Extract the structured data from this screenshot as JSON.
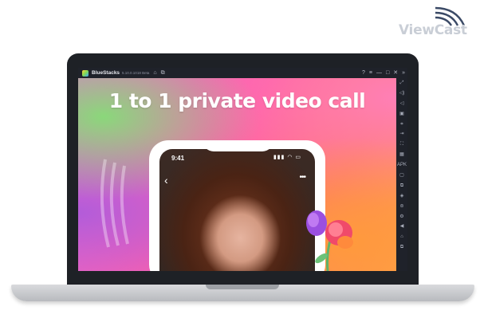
{
  "watermark": {
    "text": "ViewCast"
  },
  "titlebar": {
    "app_name": "BlueStacks",
    "version": "5.10.0.1018 Beta",
    "home_icon": "⌂",
    "multi_icon": "⧉",
    "right_icons": [
      "?",
      "≡",
      "—",
      "□",
      "✕",
      "»"
    ]
  },
  "app": {
    "headline": "1 to 1 private video call",
    "phone": {
      "time": "9:41",
      "status": "▮▮▮ ◠ ▭",
      "back_icon": "‹",
      "more_icon": "•••"
    }
  },
  "sidebar": {
    "icons": [
      "⤢",
      "◁)",
      "◁",
      "▣",
      "⌗",
      "⇥",
      "⛶",
      "▦",
      "APK",
      "▢",
      "⧉",
      "◈",
      "⊜",
      "⚙",
      "◀",
      "⌂",
      "⧉"
    ]
  },
  "colors": {
    "accent_green": "#8ad87a",
    "accent_pink": "#ff5fa8",
    "accent_orange": "#ffa24a",
    "accent_purple": "#b35cd9",
    "laptop_frame": "#1e2126",
    "titlebar_bg": "#1f222a"
  }
}
